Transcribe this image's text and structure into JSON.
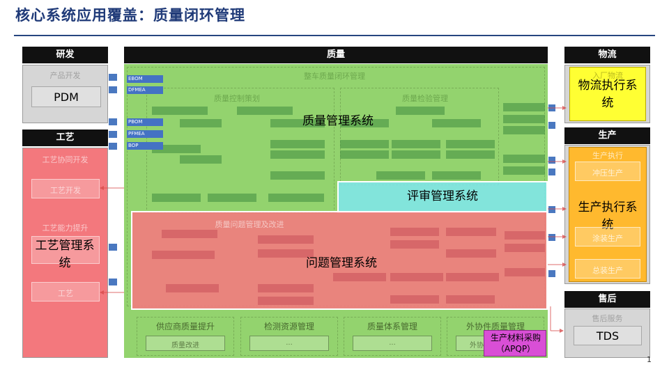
{
  "title": "核心系统应用覆盖：质量闭环管理",
  "page_number": "1",
  "columns": {
    "rd": "研发",
    "quality": "质量",
    "logistics": "物流",
    "process": "工艺",
    "production": "生产",
    "aftersales": "售后"
  },
  "rd": {
    "faint_label": "产品开发",
    "system": "PDM"
  },
  "process_col": {
    "faint_1": "工艺协同开发",
    "inner_1": "工艺开发",
    "faint_2": "工艺能力提升",
    "system": "工艺管理系统",
    "inner_2": "工艺"
  },
  "quality": {
    "faint_top": "整车质量闭环管理",
    "faint_plan": "质量控制策划",
    "faint_check": "质量检验管理",
    "faint_problem": "质量问题管理及改进",
    "system_qms": "质量管理系统",
    "system_review": "评审管理系统",
    "system_issue": "问题管理系统",
    "bottom_1": "供应商质量提升",
    "bottom_1_inner": "质量改进",
    "bottom_2": "检测资源管理",
    "bottom_2_inner": "...",
    "bottom_3": "质量体系管理",
    "bottom_3_inner": "...",
    "bottom_4": "外协件质量管理",
    "bottom_4_inner": "外协",
    "purchase": "生产材料采购（APQP）"
  },
  "left_tags": [
    "EBOM",
    "DFMEA",
    "PBOM",
    "PFMEA",
    "BOP"
  ],
  "logistics": {
    "faint_label": "入厂物流",
    "system": "物流执行系统"
  },
  "production": {
    "faint_label": "生产执行",
    "inner_1": "冲压生产",
    "system": "生产执行系统",
    "inner_2": "涂装生产",
    "inner_3": "总装生产"
  },
  "aftersales": {
    "faint_label": "售后服务",
    "system": "TDS"
  },
  "colors": {
    "title": "#1f3a78",
    "quality_green": "#8fd16a",
    "review_cyan": "#7fe6ee",
    "issue_red": "#f5797f",
    "yellow": "#ffff33",
    "orange": "#ffb92e",
    "purple": "#d94fd6"
  }
}
